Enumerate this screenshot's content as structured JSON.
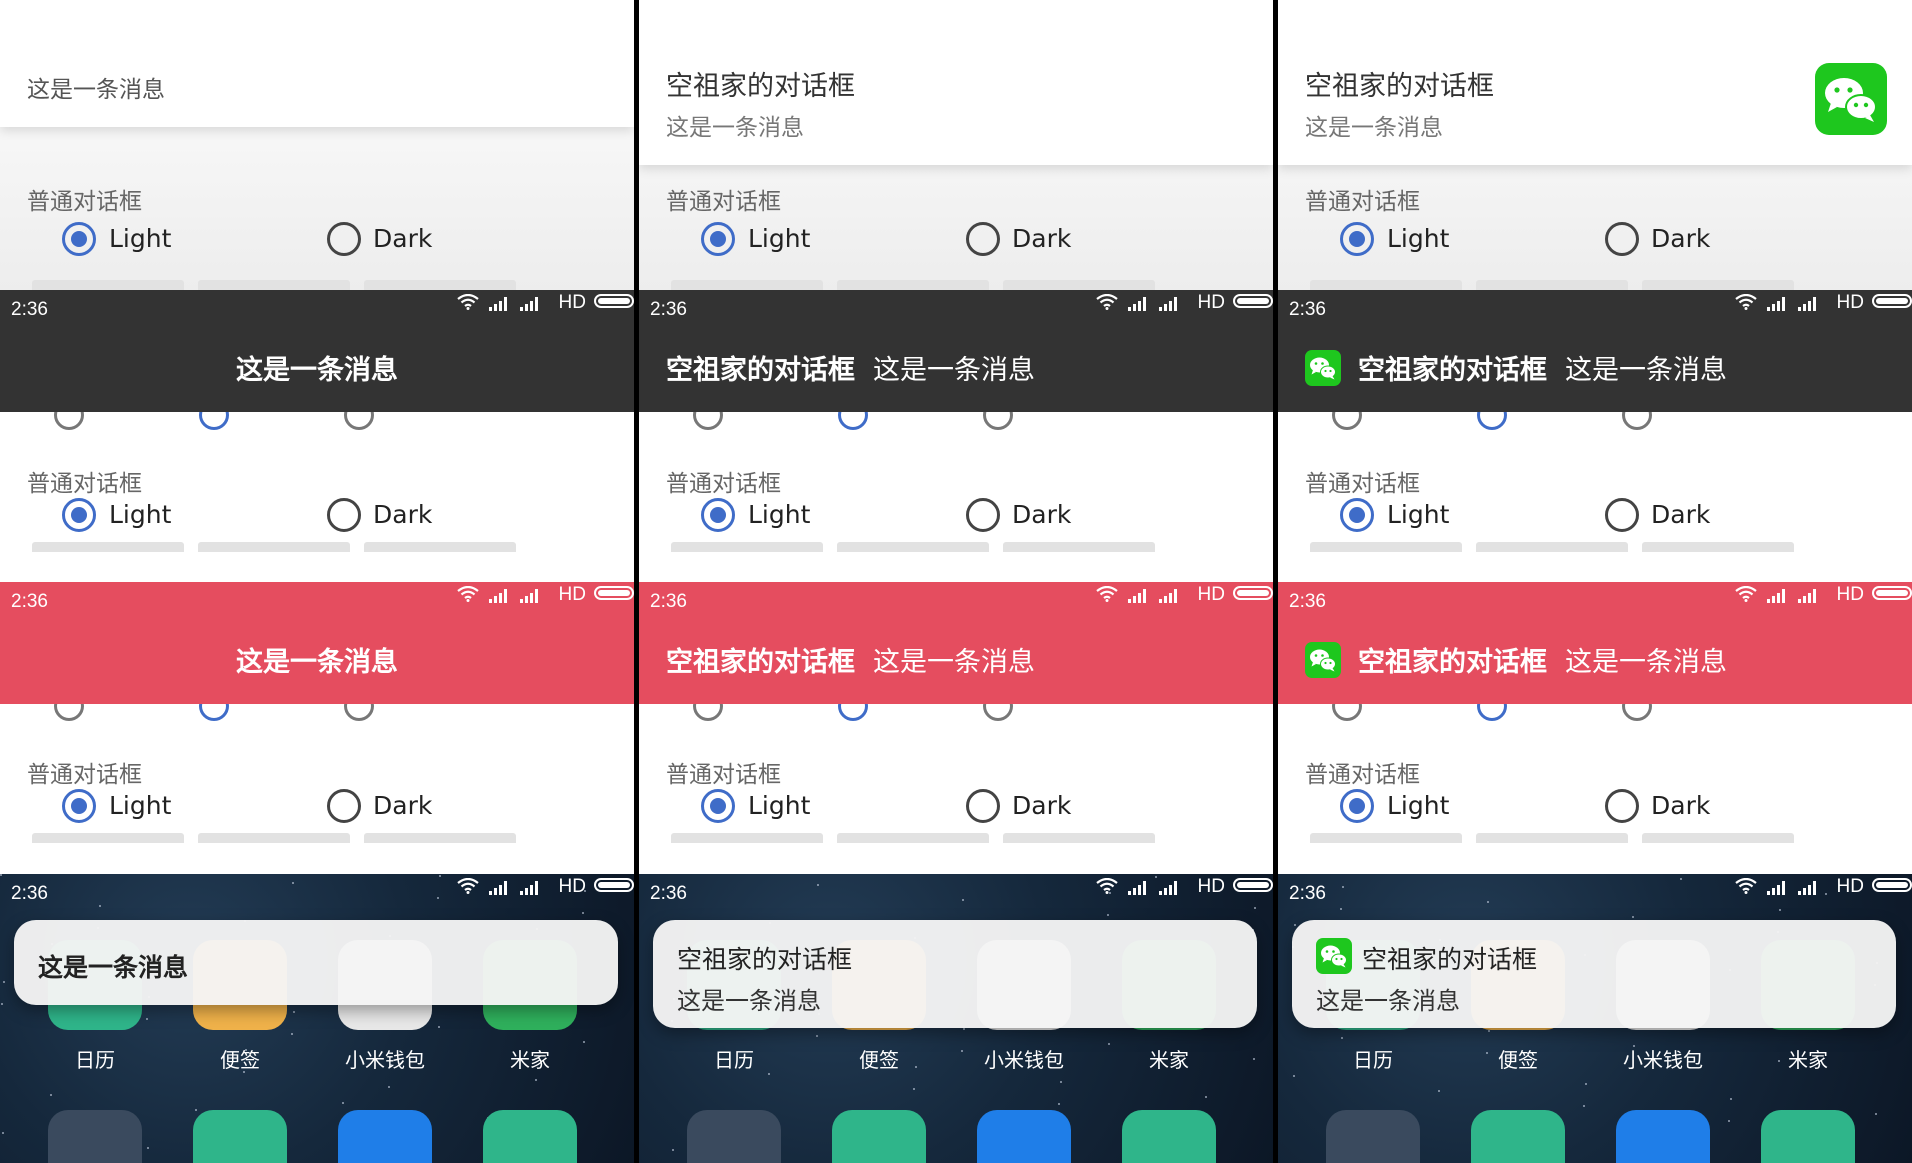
{
  "columns": [
    {
      "id": "col1",
      "white_notification": {
        "title": "",
        "message": "这是一条消息",
        "has_icon": false
      },
      "dark_banner": {
        "title": "",
        "message": "这是一条消息",
        "has_icon": false
      },
      "red_banner": {
        "title": "",
        "message": "这是一条消息",
        "has_icon": false
      },
      "floating": {
        "title": "",
        "message": "这是一条消息",
        "has_icon": false
      }
    },
    {
      "id": "col2",
      "white_notification": {
        "title": "空祖家的对话框",
        "message": "这是一条消息",
        "has_icon": false
      },
      "dark_banner": {
        "title": "空祖家的对话框",
        "message": "这是一条消息",
        "has_icon": false
      },
      "red_banner": {
        "title": "空祖家的对话框",
        "message": "这是一条消息",
        "has_icon": false
      },
      "floating": {
        "title": "空祖家的对话框",
        "message": "这是一条消息",
        "has_icon": false
      }
    },
    {
      "id": "col3",
      "white_notification": {
        "title": "空祖家的对话框",
        "message": "这是一条消息",
        "has_icon": true
      },
      "dark_banner": {
        "title": "空祖家的对话框",
        "message": "这是一条消息",
        "has_icon": true
      },
      "red_banner": {
        "title": "空祖家的对话框",
        "message": "这是一条消息",
        "has_icon": true
      },
      "floating": {
        "title": "空祖家的对话框",
        "message": "这是一条消息",
        "has_icon": true
      }
    }
  ],
  "settings": {
    "section_title": "普通对话框",
    "light_label": "Light",
    "dark_label": "Dark",
    "selected": "Light"
  },
  "status_bar": {
    "time": "2:36",
    "network": "HD"
  },
  "home_apps": [
    {
      "label": "日历",
      "color": "#2fb58a",
      "icon": "calendar-icon"
    },
    {
      "label": "便签",
      "color": "#f0b24a",
      "icon": "notes-icon"
    },
    {
      "label": "小米钱包",
      "color": "#e8e8e8",
      "icon": "wallet-icon"
    },
    {
      "label": "米家",
      "color": "#2fb05c",
      "icon": "mijia-icon"
    }
  ],
  "dock_apps": [
    {
      "icon": "folder-icon",
      "color": "#3a4a5e"
    },
    {
      "icon": "compass-icon",
      "color": "#2fb58a"
    },
    {
      "icon": "screen-icon",
      "color": "#1f7ee8"
    },
    {
      "icon": "shop-icon",
      "color": "#2fb58a"
    }
  ],
  "colors": {
    "banner_dark": "#333333",
    "banner_red": "#e54d5f",
    "radio_selected": "#3f6cc8",
    "wechat_green": "#1ec71e"
  }
}
